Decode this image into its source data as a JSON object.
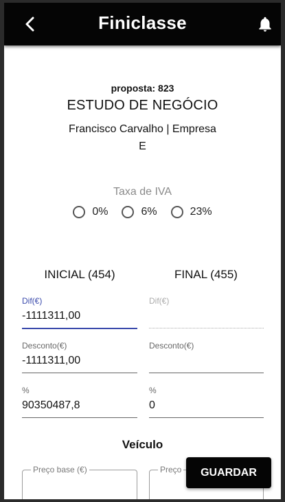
{
  "app": {
    "title": "Finiclasse"
  },
  "header": {
    "proposal": "proposta: 823",
    "title": "ESTUDO DE NEGÓCIO",
    "client_line1": "Francisco Carvalho | Empresa",
    "client_line2": "E"
  },
  "vat": {
    "label": "Taxa de IVA",
    "options": [
      "0%",
      "6%",
      "23%"
    ]
  },
  "columns": {
    "initial": "INICIAL (454)",
    "final": "FINAL (455)"
  },
  "initial": {
    "dif_label": "Dif(€)",
    "dif_value": "-1111311,00",
    "desconto_label": "Desconto(€)",
    "desconto_value": "-1111311,00",
    "pct_label": "%",
    "pct_value": "90350487,8"
  },
  "final": {
    "dif_label": "Dif(€)",
    "dif_value": "",
    "desconto_label": "Desconto(€)",
    "desconto_value": "",
    "pct_label": "%",
    "pct_value": "0"
  },
  "vehicle": {
    "title": "Veículo",
    "preco_base_label": "Preço base (€)",
    "preco_final_label": "Preço"
  },
  "actions": {
    "save": "GUARDAR"
  }
}
